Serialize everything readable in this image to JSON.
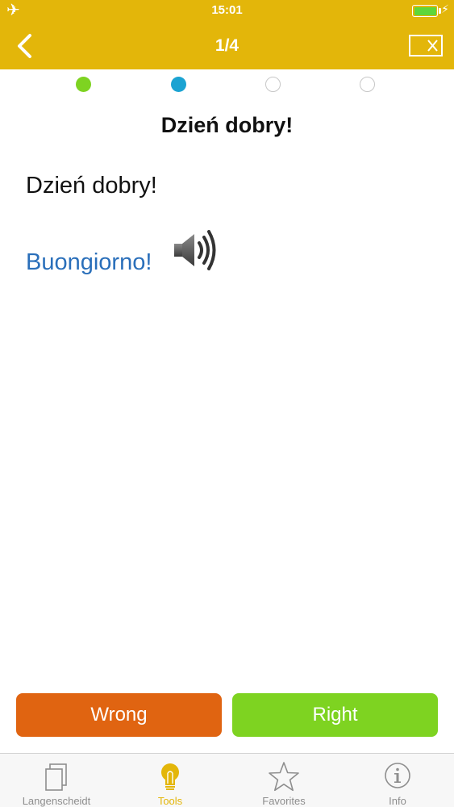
{
  "status_bar": {
    "time": "15:01",
    "airplane_icon": "airplane-icon",
    "battery_icon": "battery-icon",
    "charging_icon": "charging-bolt-icon"
  },
  "nav": {
    "title": "1/4",
    "back_icon": "chevron-left-icon",
    "close_icon": "close-x-icon"
  },
  "progress": {
    "total": 4,
    "dots": [
      {
        "state": "done",
        "color": "#7ed321"
      },
      {
        "state": "current",
        "color": "#1ba3d2"
      },
      {
        "state": "pending",
        "color": "#ffffff"
      },
      {
        "state": "pending",
        "color": "#ffffff"
      }
    ]
  },
  "card": {
    "title": "Dzień dobry!",
    "source_text": "Dzień dobry!",
    "translation": "Buongiorno!",
    "speaker_icon": "speaker-icon"
  },
  "actions": {
    "wrong_label": "Wrong",
    "right_label": "Right"
  },
  "tabbar": {
    "tabs": [
      {
        "label": "Langenscheidt",
        "icon": "book-icon",
        "active": false
      },
      {
        "label": "Tools",
        "icon": "lightbulb-icon",
        "active": true
      },
      {
        "label": "Favorites",
        "icon": "star-icon",
        "active": false
      },
      {
        "label": "Info",
        "icon": "info-icon",
        "active": false
      }
    ]
  },
  "colors": {
    "accent": "#e3b60a",
    "wrong": "#e06411",
    "right": "#7ed321",
    "translation": "#2a6fba"
  }
}
